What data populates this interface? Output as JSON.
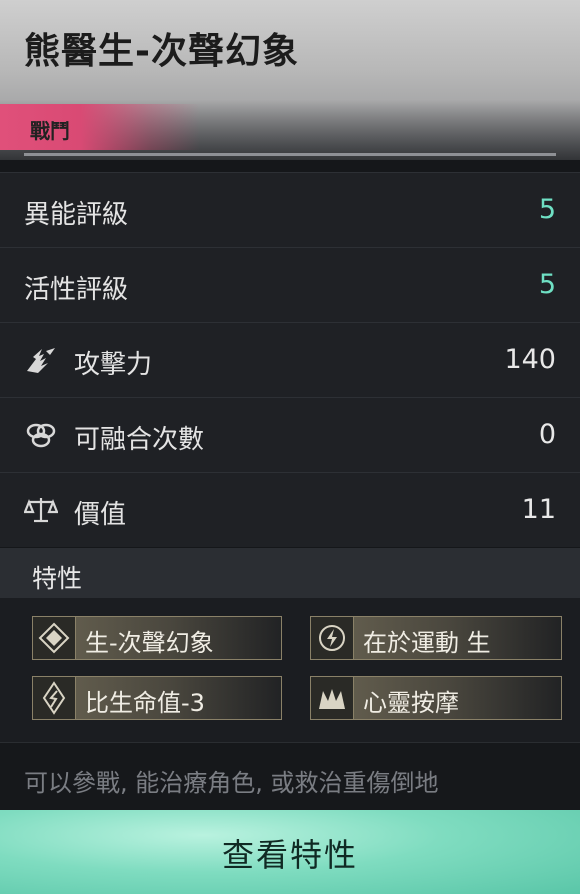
{
  "header": {
    "title": "熊醫生-次聲幻象",
    "tag": "戰鬥"
  },
  "stats": [
    {
      "label": "異能評級",
      "value": "5",
      "icon": ""
    },
    {
      "label": "活性評級",
      "value": "5",
      "icon": ""
    },
    {
      "label": "攻擊力",
      "value": "140",
      "icon": "claw-icon"
    },
    {
      "label": "可融合次數",
      "value": "0",
      "icon": "fusion-icon"
    },
    {
      "label": "價值",
      "value": "11",
      "icon": "scale-icon"
    }
  ],
  "colors": {
    "accent_teal": "#6fe0c4",
    "tag_pink": "#e0507a",
    "button": "#7fdcc0"
  },
  "traits": {
    "heading": "特性",
    "items": [
      {
        "label": "生-次聲幻象",
        "icon": "diamond-icon"
      },
      {
        "label": "在於運動 生",
        "icon": "target-icon"
      },
      {
        "label": "比生命值-3",
        "icon": "crystal-icon"
      },
      {
        "label": "心靈按摩",
        "icon": "massage-icon"
      }
    ]
  },
  "description": "可以參戰, 能治療角色, 或救治重傷倒地",
  "button": {
    "label": "查看特性"
  }
}
